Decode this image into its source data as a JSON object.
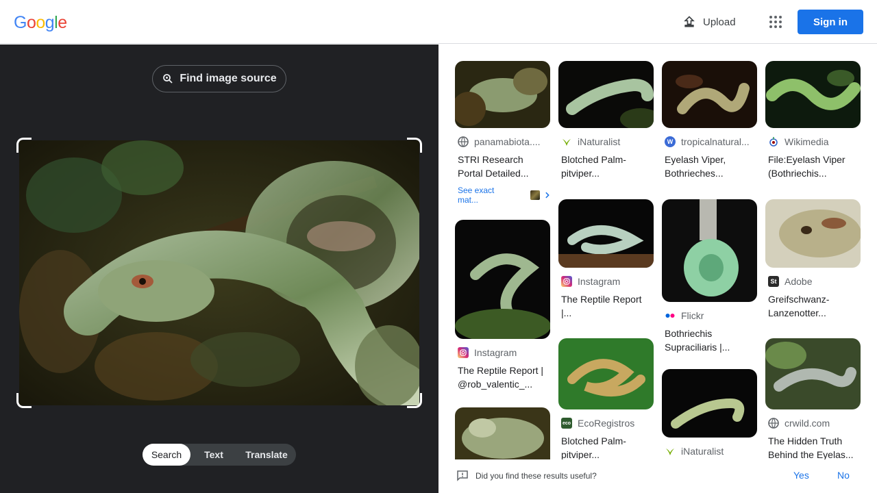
{
  "logo": {
    "letters": [
      "G",
      "o",
      "o",
      "g",
      "l",
      "e"
    ],
    "colors": [
      "#4285f4",
      "#ea4335",
      "#fbbc05",
      "#4285f4",
      "#34a853",
      "#ea4335"
    ]
  },
  "header": {
    "upload_label": "Upload",
    "signin_label": "Sign in"
  },
  "left": {
    "find_source_label": "Find image source",
    "modes": [
      "Search",
      "Text",
      "Translate"
    ],
    "active_mode": "Search"
  },
  "results": [
    {
      "source": "panamabiota....",
      "icon": "globe-icon",
      "icon_color": "#5f6368",
      "title": "STRI Research Portal Detailed...",
      "exact_label": "See exact mat..."
    },
    {
      "source": "iNaturalist",
      "icon": "inaturalist-icon",
      "icon_color": "#74ac00",
      "title": "Blotched Palm-pitviper..."
    },
    {
      "source": "tropicalnatural...",
      "icon": "wordpress-icon",
      "icon_color": "#3b6bd6",
      "title": "Eyelash Viper, Bothrieches..."
    },
    {
      "source": "Wikimedia",
      "icon": "wikimedia-icon",
      "icon_color": "#3366cc",
      "title": "File:Eyelash Viper (Bothriechis..."
    },
    {
      "source": "Instagram",
      "icon": "instagram-icon",
      "icon_color": "#d6249f",
      "title": "The Reptile Report | @rob_valentic_..."
    },
    {
      "source": "Instagram",
      "icon": "instagram-icon",
      "icon_color": "#d6249f",
      "title": "The Reptile Report |..."
    },
    {
      "source": "Flickr",
      "icon": "flickr-icon",
      "icon_color": "#0063dc",
      "title": "Bothriechis Supraciliaris |..."
    },
    {
      "source": "Adobe",
      "icon": "adobe-stock-icon",
      "icon_color": "#2b2b2b",
      "title": "Greifschwanz-Lanzenotter..."
    },
    {
      "source": "EcoRegistros",
      "icon": "ecoregistros-icon",
      "icon_color": "#2e5b2e",
      "title": "Blotched Palm-pitviper..."
    },
    {
      "source": "iNaturalist",
      "icon": "inaturalist-icon",
      "icon_color": "#74ac00",
      "title": ""
    },
    {
      "source": "crwild.com",
      "icon": "globe-icon",
      "icon_color": "#5f6368",
      "title": "The Hidden Truth Behind the Eyelas..."
    }
  ],
  "feedback": {
    "question": "Did you find these results useful?",
    "yes": "Yes",
    "no": "No"
  }
}
